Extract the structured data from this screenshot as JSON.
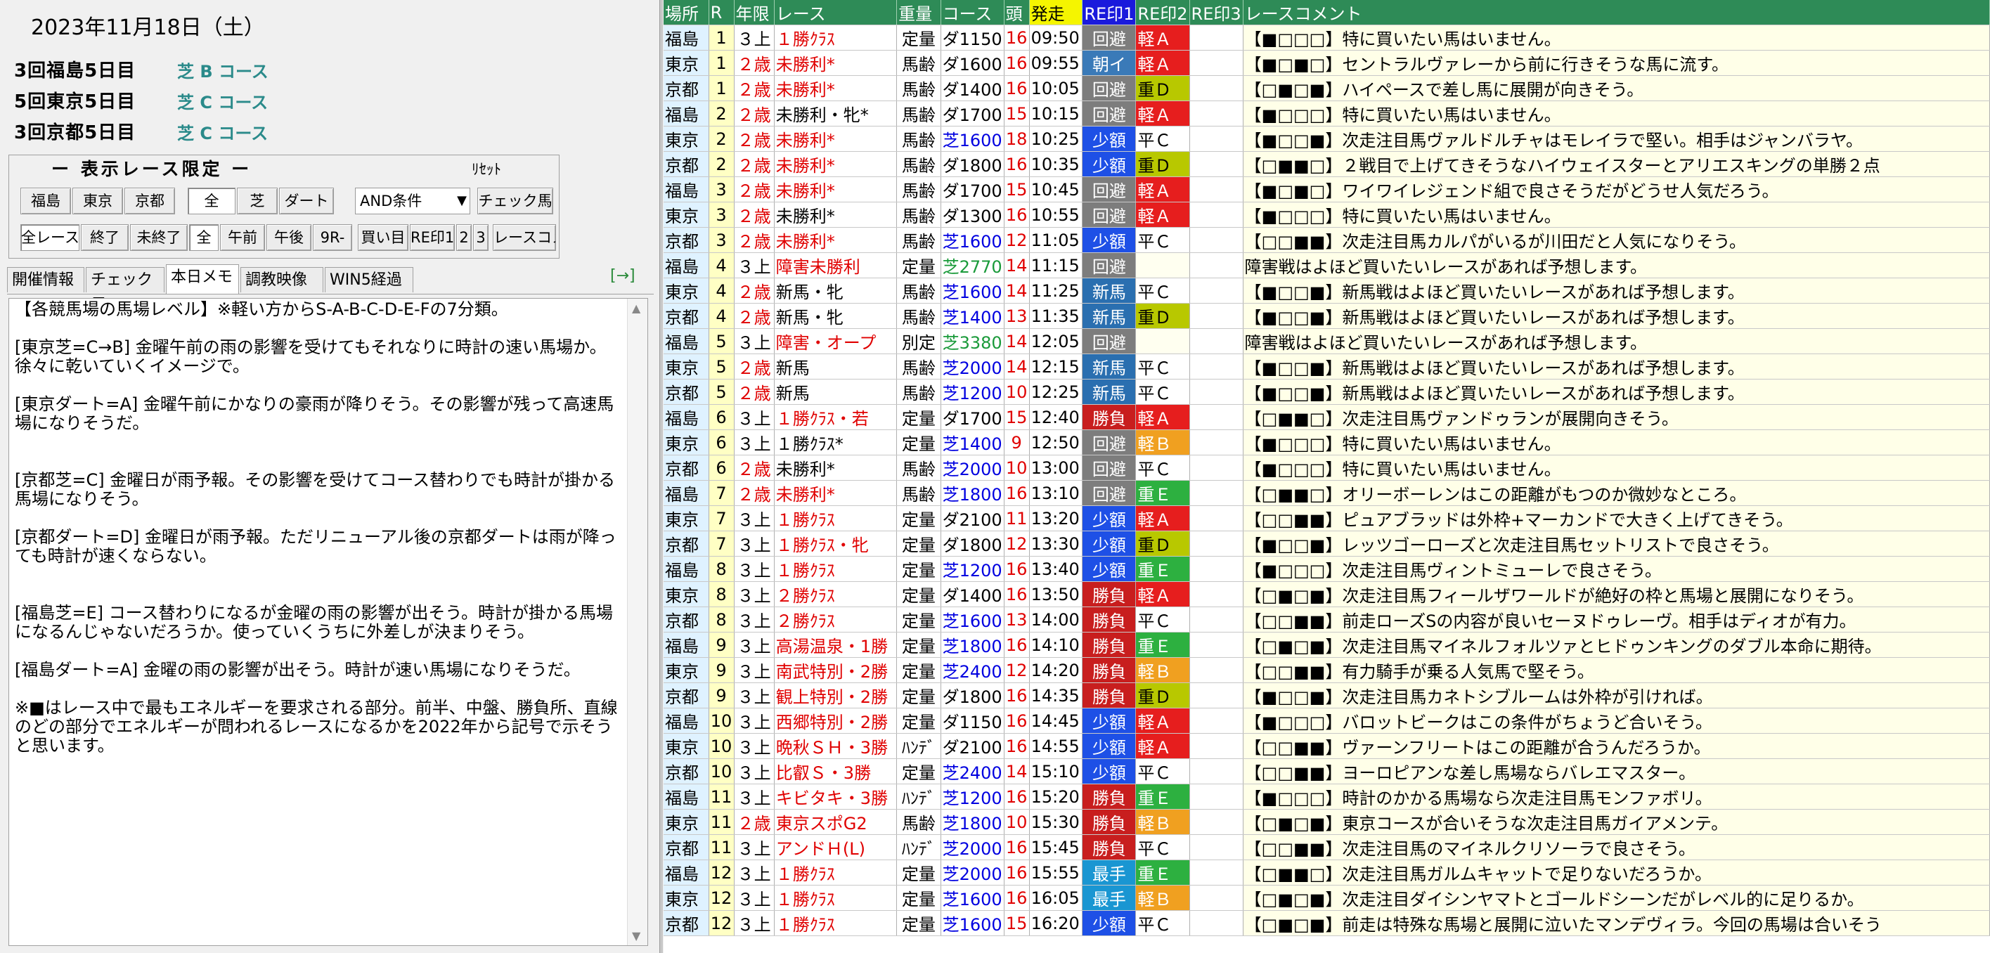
{
  "left": {
    "date": "2023年11月18日（土）",
    "meetings": [
      {
        "name": "3回福島5日目",
        "course": "芝 B コース"
      },
      {
        "name": "5回東京5日目",
        "course": "芝 C コース"
      },
      {
        "name": "3回京都5日目",
        "course": "芝 C コース"
      }
    ],
    "filter": {
      "title": "ー 表示レース限定 ー",
      "reset": "ﾘｾｯﾄ",
      "row1": [
        "福島",
        "東京",
        "京都",
        "全",
        "芝",
        "ダート"
      ],
      "and_select": "AND条件",
      "check_horse": "チェック馬",
      "row2": [
        "全レース",
        "終了",
        "未終了",
        "全",
        "午前",
        "午後",
        "9R-",
        "買い目",
        "RE印1",
        "2",
        "3",
        "レースコメ"
      ]
    },
    "tabs": [
      "開催情報",
      "チェック馬",
      "本日メモ",
      "調教映像",
      "WIN5経過"
    ],
    "active_tab": "本日メモ",
    "arrow_link": "[→]",
    "memo": "【各競馬場の馬場レベル】※軽い方からS-A-B-C-D-E-Fの7分類。\n\n[東京芝=C→B] 金曜午前の雨の影響を受けてもそれなりに時計の速い馬場か。徐々に乾いていくイメージで。\n\n[東京ダート=A] 金曜午前にかなりの豪雨が降りそう。その影響が残って高速馬場になりそうだ。\n\n\n[京都芝=C] 金曜日が雨予報。その影響を受けてコース替わりでも時計が掛かる馬場になりそう。\n\n[京都ダート=D] 金曜日が雨予報。ただリニューアル後の京都ダートは雨が降っても時計が速くならない。\n\n\n[福島芝=E] コース替わりになるが金曜の雨の影響が出そう。時計が掛かる馬場になるんじゃないだろうか。使っていくうちに外差しが決まりそう。\n\n[福島ダート=A] 金曜の雨の影響が出そう。時計が速い馬場になりそうだ。\n\n※■はレース中で最もエネルギーを要求される部分。前半、中盤、勝負所、直線のどの部分でエネルギーが問われるレースになるかを2022年から記号で示そうと思います。"
  },
  "grid": {
    "headers": [
      "場所",
      "R",
      "年限",
      "レース",
      "重量",
      "コース",
      "頭",
      "発走",
      "RE印1",
      "RE印2",
      "RE印3",
      "レースコメント"
    ],
    "colors": {
      "header_bg": "#2e8b57",
      "start_header_bg": "#f5f500",
      "re1_header_bg": "#1a1adc"
    },
    "rows": [
      {
        "venue": "福島",
        "r": "1",
        "age": "３上",
        "race": "１勝ｸﾗｽ",
        "race_red": true,
        "weight": "定量",
        "course": "ダ1150",
        "turf": false,
        "heads": "16",
        "time": "09:50",
        "re1": "回避",
        "re1c": "kaihi",
        "re2": "軽Ａ",
        "re2c": "A",
        "re3": "",
        "comment": "【■□□□】特に買いたい馬はいません。"
      },
      {
        "venue": "東京",
        "r": "1",
        "age": "２歳",
        "age_red": true,
        "race": "未勝利*",
        "race_red": true,
        "weight": "馬齢",
        "course": "ダ1600",
        "turf": false,
        "heads": "16",
        "time": "09:55",
        "re1": "朝イ",
        "re1c": "asa",
        "re2": "軽Ａ",
        "re2c": "A",
        "re3": "",
        "comment": "【■□■□】セントラルヴァレーから前に行きそうな馬に流す。"
      },
      {
        "venue": "京都",
        "r": "1",
        "age": "２歳",
        "age_red": true,
        "race": "未勝利*",
        "race_red": true,
        "weight": "馬齢",
        "course": "ダ1400",
        "turf": false,
        "heads": "16",
        "time": "10:05",
        "re1": "回避",
        "re1c": "kaihi",
        "re2": "重Ｄ",
        "re2c": "D",
        "re3": "",
        "comment": "【□■□■】ハイペースで差し馬に展開が向きそう。"
      },
      {
        "venue": "福島",
        "r": "2",
        "age": "２歳",
        "age_red": true,
        "race": "未勝利・牝*",
        "race_red": false,
        "weight": "馬齢",
        "course": "ダ1700",
        "turf": false,
        "heads": "15",
        "time": "10:15",
        "re1": "回避",
        "re1c": "kaihi",
        "re2": "軽Ａ",
        "re2c": "A",
        "re3": "",
        "comment": "【■□□□】特に買いたい馬はいません。"
      },
      {
        "venue": "東京",
        "r": "2",
        "age": "２歳",
        "age_red": true,
        "race": "未勝利*",
        "race_red": true,
        "weight": "馬齢",
        "course": "芝1600",
        "turf": true,
        "heads": "18",
        "time": "10:25",
        "re1": "少額",
        "re1c": "shogaku",
        "re2": "平Ｃ",
        "re2c": "C",
        "re3": "",
        "comment": "【■□□■】次走注目馬ヴァルドルチャはモレイラで堅い。相手はジャンバラヤ。"
      },
      {
        "venue": "京都",
        "r": "2",
        "age": "２歳",
        "age_red": true,
        "race": "未勝利*",
        "race_red": true,
        "weight": "馬齢",
        "course": "ダ1800",
        "turf": false,
        "heads": "16",
        "time": "10:35",
        "re1": "少額",
        "re1c": "shogaku",
        "re2": "重Ｄ",
        "re2c": "D",
        "re3": "",
        "comment": "【□■■□】２戦目で上げてきそうなハイウェイスターとアリエスキングの単勝２点"
      },
      {
        "venue": "福島",
        "r": "3",
        "age": "２歳",
        "age_red": true,
        "race": "未勝利*",
        "race_red": true,
        "weight": "馬齢",
        "course": "ダ1700",
        "turf": false,
        "heads": "15",
        "time": "10:45",
        "re1": "回避",
        "re1c": "kaihi",
        "re2": "軽Ａ",
        "re2c": "A",
        "re3": "",
        "comment": "【■□■□】ワイワイレジェンド組で良さそうだがどうせ人気だろう。"
      },
      {
        "venue": "東京",
        "r": "3",
        "age": "２歳",
        "age_red": true,
        "race": "未勝利*",
        "race_red": false,
        "weight": "馬齢",
        "course": "ダ1300",
        "turf": false,
        "heads": "16",
        "time": "10:55",
        "re1": "回避",
        "re1c": "kaihi",
        "re2": "軽Ａ",
        "re2c": "A",
        "re3": "",
        "comment": "【■□□□】特に買いたい馬はいません。"
      },
      {
        "venue": "京都",
        "r": "3",
        "age": "２歳",
        "age_red": true,
        "race": "未勝利*",
        "race_red": true,
        "weight": "馬齢",
        "course": "芝1600",
        "turf": true,
        "heads": "12",
        "time": "11:05",
        "re1": "少額",
        "re1c": "shogaku",
        "re2": "平Ｃ",
        "re2c": "C",
        "re3": "",
        "comment": "【□□■■】次走注目馬カルパがいるが川田だと人気になりそう。"
      },
      {
        "venue": "福島",
        "r": "4",
        "age": "３上",
        "race": "障害未勝利",
        "race_red": true,
        "weight": "定量",
        "course": "芝2770",
        "turf": true,
        "turf_green": true,
        "heads": "14",
        "time": "11:15",
        "re1": "回避",
        "re1c": "kaihi",
        "re2": "",
        "re2c": "none",
        "re3": "",
        "comment": "障害戦はよほど買いたいレースがあれば予想します。"
      },
      {
        "venue": "東京",
        "r": "4",
        "age": "２歳",
        "age_red": true,
        "race": "新馬・牝",
        "race_red": false,
        "weight": "馬齢",
        "course": "芝1600",
        "turf": true,
        "heads": "14",
        "time": "11:25",
        "re1": "新馬",
        "re1c": "shinba",
        "re2": "平Ｃ",
        "re2c": "C",
        "re3": "",
        "comment": "【■□□■】新馬戦はよほど買いたいレースがあれば予想します。"
      },
      {
        "venue": "京都",
        "r": "4",
        "age": "２歳",
        "age_red": true,
        "race": "新馬・牝",
        "race_red": false,
        "weight": "馬齢",
        "course": "芝1400",
        "turf": true,
        "heads": "13",
        "time": "11:35",
        "re1": "新馬",
        "re1c": "shinba",
        "re2": "重Ｄ",
        "re2c": "D",
        "re3": "",
        "comment": "【■□□■】新馬戦はよほど買いたいレースがあれば予想します。"
      },
      {
        "venue": "福島",
        "r": "5",
        "age": "３上",
        "race": "障害・オープ",
        "race_red": true,
        "weight": "別定",
        "course": "芝3380",
        "turf": true,
        "turf_green": true,
        "heads": "14",
        "time": "12:05",
        "re1": "回避",
        "re1c": "kaihi",
        "re2": "",
        "re2c": "none",
        "re3": "",
        "comment": "障害戦はよほど買いたいレースがあれば予想します。"
      },
      {
        "venue": "東京",
        "r": "5",
        "age": "２歳",
        "age_red": true,
        "race": "新馬",
        "race_red": false,
        "weight": "馬齢",
        "course": "芝2000",
        "turf": true,
        "heads": "14",
        "time": "12:15",
        "re1": "新馬",
        "re1c": "shinba",
        "re2": "平Ｃ",
        "re2c": "C",
        "re3": "",
        "comment": "【■□□■】新馬戦はよほど買いたいレースがあれば予想します。"
      },
      {
        "venue": "京都",
        "r": "5",
        "age": "２歳",
        "age_red": true,
        "race": "新馬",
        "race_red": false,
        "weight": "馬齢",
        "course": "芝1200",
        "turf": true,
        "heads": "10",
        "time": "12:25",
        "re1": "新馬",
        "re1c": "shinba",
        "re2": "平Ｃ",
        "re2c": "C",
        "re3": "",
        "comment": "【■□□■】新馬戦はよほど買いたいレースがあれば予想します。"
      },
      {
        "venue": "福島",
        "r": "6",
        "age": "３上",
        "race": "１勝ｸﾗｽ・若",
        "race_red": true,
        "weight": "定量",
        "course": "ダ1700",
        "turf": false,
        "heads": "15",
        "time": "12:40",
        "re1": "勝負",
        "re1c": "shobu",
        "re2": "軽Ａ",
        "re2c": "A",
        "re3": "",
        "comment": "【□■■□】次走注目馬ヴァンドゥランが展開向きそう。"
      },
      {
        "venue": "東京",
        "r": "6",
        "age": "３上",
        "race": "１勝ｸﾗｽ*",
        "race_red": false,
        "weight": "定量",
        "course": "芝1400",
        "turf": true,
        "heads": "9",
        "time": "12:50",
        "re1": "回避",
        "re1c": "kaihi",
        "re2": "軽Ｂ",
        "re2c": "B",
        "re3": "",
        "comment": "【■□□□】特に買いたい馬はいません。"
      },
      {
        "venue": "京都",
        "r": "6",
        "age": "２歳",
        "age_red": true,
        "race": "未勝利*",
        "race_red": false,
        "weight": "馬齢",
        "course": "芝2000",
        "turf": true,
        "heads": "10",
        "time": "13:00",
        "re1": "回避",
        "re1c": "kaihi",
        "re2": "平Ｃ",
        "re2c": "C",
        "re3": "",
        "comment": "【■□□□】特に買いたい馬はいません。"
      },
      {
        "venue": "福島",
        "r": "7",
        "age": "２歳",
        "age_red": true,
        "race": "未勝利*",
        "race_red": true,
        "weight": "馬齢",
        "course": "芝1800",
        "turf": true,
        "heads": "16",
        "time": "13:10",
        "re1": "回避",
        "re1c": "kaihi",
        "re2": "重Ｅ",
        "re2c": "E",
        "re3": "",
        "comment": "【□■■□】オリーボーレンはこの距離がもつのか微妙なところ。"
      },
      {
        "venue": "東京",
        "r": "7",
        "age": "３上",
        "race": "１勝ｸﾗｽ",
        "race_red": true,
        "weight": "定量",
        "course": "ダ2100",
        "turf": false,
        "heads": "11",
        "time": "13:20",
        "re1": "少額",
        "re1c": "shogaku",
        "re2": "軽Ａ",
        "re2c": "A",
        "re3": "",
        "comment": "【□□■■】ピュアブラッドは外枠+マーカンドで大きく上げてきそう。"
      },
      {
        "venue": "京都",
        "r": "7",
        "age": "３上",
        "race": "１勝ｸﾗｽ・牝",
        "race_red": true,
        "weight": "定量",
        "course": "ダ1800",
        "turf": false,
        "heads": "12",
        "time": "13:30",
        "re1": "少額",
        "re1c": "shogaku",
        "re2": "重Ｄ",
        "re2c": "D",
        "re3": "",
        "comment": "【■□□■】レッツゴーローズと次走注目馬セットリストで良さそう。"
      },
      {
        "venue": "福島",
        "r": "8",
        "age": "３上",
        "race": "１勝ｸﾗｽ",
        "race_red": true,
        "weight": "定量",
        "course": "芝1200",
        "turf": true,
        "heads": "16",
        "time": "13:40",
        "re1": "少額",
        "re1c": "shogaku",
        "re2": "重Ｅ",
        "re2c": "E",
        "re3": "",
        "comment": "【■□□□】次走注目馬ヴィントミューレで良さそう。"
      },
      {
        "venue": "東京",
        "r": "8",
        "age": "３上",
        "race": "２勝ｸﾗｽ",
        "race_red": true,
        "weight": "定量",
        "course": "ダ1400",
        "turf": false,
        "heads": "16",
        "time": "13:50",
        "re1": "勝負",
        "re1c": "shobu",
        "re2": "軽Ａ",
        "re2c": "A",
        "re3": "",
        "comment": "【□■□■】次走注目馬フィールザワールドが絶好の枠と馬場と展開になりそう。"
      },
      {
        "venue": "京都",
        "r": "8",
        "age": "３上",
        "race": "２勝ｸﾗｽ",
        "race_red": true,
        "weight": "定量",
        "course": "芝1600",
        "turf": true,
        "heads": "13",
        "time": "14:00",
        "re1": "勝負",
        "re1c": "shobu",
        "re2": "平Ｃ",
        "re2c": "C",
        "re3": "",
        "comment": "【□□■■】前走ローズSの内容が良いセーヌドゥレーヴ。相手はディオが有力。"
      },
      {
        "venue": "福島",
        "r": "9",
        "age": "３上",
        "race": "高湯温泉・1勝",
        "race_red": true,
        "weight": "定量",
        "course": "芝1800",
        "turf": true,
        "heads": "16",
        "time": "14:10",
        "re1": "勝負",
        "re1c": "shobu",
        "re2": "重Ｅ",
        "re2c": "E",
        "re3": "",
        "comment": "【□■□■】次走注目馬マイネルフォルツァとヒドゥンキングのダブル本命に期待。"
      },
      {
        "venue": "東京",
        "r": "9",
        "age": "３上",
        "race": "南武特別・2勝",
        "race_red": true,
        "weight": "定量",
        "course": "芝2400",
        "turf": true,
        "heads": "12",
        "time": "14:20",
        "re1": "勝負",
        "re1c": "shobu",
        "re2": "軽Ｂ",
        "re2c": "B",
        "re3": "",
        "comment": "【□□■■】有力騎手が乗る人気馬で堅そう。"
      },
      {
        "venue": "京都",
        "r": "9",
        "age": "３上",
        "race": "観上特別・2勝",
        "race_red": true,
        "weight": "定量",
        "course": "ダ1800",
        "turf": false,
        "heads": "16",
        "time": "14:35",
        "re1": "勝負",
        "re1c": "shobu",
        "re2": "重Ｄ",
        "re2c": "D",
        "re3": "",
        "comment": "【■□□■】次走注目馬カネトシブルームは外枠が引ければ。"
      },
      {
        "venue": "福島",
        "r": "10",
        "age": "３上",
        "race": "西郷特別・2勝",
        "race_red": true,
        "weight": "定量",
        "course": "ダ1150",
        "turf": false,
        "heads": "16",
        "time": "14:45",
        "re1": "少額",
        "re1c": "shogaku",
        "re2": "軽Ａ",
        "re2c": "A",
        "re3": "",
        "comment": "【■□□□】バロットビークはこの条件がちょうど合いそう。"
      },
      {
        "venue": "東京",
        "r": "10",
        "age": "３上",
        "race": "晩秋ＳＨ・3勝",
        "race_red": true,
        "weight": "ﾊﾝﾃﾞ",
        "course": "ダ2100",
        "turf": false,
        "heads": "16",
        "time": "14:55",
        "re1": "少額",
        "re1c": "shogaku",
        "re2": "軽Ａ",
        "re2c": "A",
        "re3": "",
        "comment": "【□□■■】ヴァーンフリートはこの距離が合うんだろうか。"
      },
      {
        "venue": "京都",
        "r": "10",
        "age": "３上",
        "race": "比叡Ｓ・3勝",
        "race_red": true,
        "weight": "定量",
        "course": "芝2400",
        "turf": true,
        "heads": "14",
        "time": "15:10",
        "re1": "少額",
        "re1c": "shogaku",
        "re2": "平Ｃ",
        "re2c": "C",
        "re3": "",
        "comment": "【□□■■】ヨーロピアンな差し馬場ならバレエマスター。"
      },
      {
        "venue": "福島",
        "r": "11",
        "age": "３上",
        "race": "キビタキ・3勝",
        "race_red": true,
        "weight": "ﾊﾝﾃﾞ",
        "course": "芝1200",
        "turf": true,
        "heads": "16",
        "time": "15:20",
        "re1": "勝負",
        "re1c": "shobu",
        "re2": "重Ｅ",
        "re2c": "E",
        "re3": "",
        "comment": "【■□□□】時計のかかる馬場なら次走注目馬モンファボリ。"
      },
      {
        "venue": "東京",
        "r": "11",
        "age": "２歳",
        "age_red": true,
        "race": "東京スポG2",
        "race_red": true,
        "weight": "馬齢",
        "course": "芝1800",
        "turf": true,
        "heads": "10",
        "time": "15:30",
        "re1": "勝負",
        "re1c": "shobu",
        "re2": "軽Ｂ",
        "re2c": "B",
        "re3": "",
        "comment": "【□■□■】東京コースが合いそうな次走注目馬ガイアメンテ。"
      },
      {
        "venue": "京都",
        "r": "11",
        "age": "３上",
        "race": "アンドＨ(L)",
        "race_red": true,
        "weight": "ﾊﾝﾃﾞ",
        "course": "芝2000",
        "turf": true,
        "heads": "16",
        "time": "15:45",
        "re1": "勝負",
        "re1c": "shobu",
        "re2": "平Ｃ",
        "re2c": "C",
        "re3": "",
        "comment": "【□□■■】次走注目馬のマイネルクリソーラで良さそう。"
      },
      {
        "venue": "福島",
        "r": "12",
        "age": "３上",
        "race": "１勝ｸﾗｽ",
        "race_red": true,
        "weight": "定量",
        "course": "芝2000",
        "turf": true,
        "heads": "16",
        "time": "15:55",
        "re1": "最手",
        "re1c": "saite",
        "re2": "重Ｅ",
        "re2c": "E",
        "re3": "",
        "comment": "【□■■□】次走注目馬ガルムキャットで足りないだろうか。"
      },
      {
        "venue": "東京",
        "r": "12",
        "age": "３上",
        "race": "１勝ｸﾗｽ",
        "race_red": true,
        "weight": "定量",
        "course": "芝1600",
        "turf": true,
        "heads": "16",
        "time": "16:05",
        "re1": "最手",
        "re1c": "saite",
        "re2": "軽Ｂ",
        "re2c": "B",
        "re3": "",
        "comment": "【□■□■】次走注目ダイシンヤマトとゴールドシーンだがレベル的に足りるか。"
      },
      {
        "venue": "京都",
        "r": "12",
        "age": "３上",
        "race": "１勝ｸﾗｽ",
        "race_red": true,
        "weight": "定量",
        "course": "芝1600",
        "turf": true,
        "heads": "15",
        "time": "16:20",
        "re1": "少額",
        "re1c": "shogaku",
        "re2": "平Ｃ",
        "re2c": "C",
        "re3": "",
        "comment": "【□■□■】前走は特殊な馬場と展開に泣いたマンデヴィラ。今回の馬場は合いそう"
      }
    ]
  }
}
